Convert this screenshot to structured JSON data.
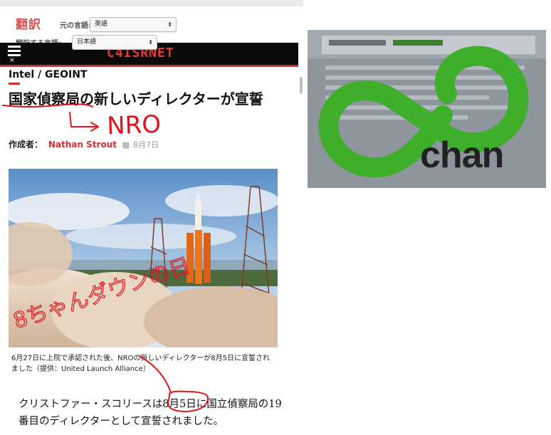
{
  "translate_bar": {
    "title": "翻訳",
    "source_label": "元の言語:",
    "source_value": "英語",
    "target_label": "翻訳する言語:",
    "target_value": "日本語"
  },
  "site": {
    "menu_close": "×",
    "logo": "C4ISRNET",
    "accent_color": "#d32f2f"
  },
  "article": {
    "category": "Intel / GEOINT",
    "headline": "国家偵察局の新しいディレクターが宣誓",
    "byline_label": "作成者：",
    "author": "Nathan Strout",
    "date": "8月7日",
    "caption": "6月27日に上院で承認された後、NROの新しいディレクターが8月5日に宣誓されました（提供：United Launch Alliance）",
    "body": "クリストファー・スコリースは8月5日に国立偵察局の19番目のディレクターとして宣誓されました。"
  },
  "annotations": {
    "nro": "NRO",
    "eight_chan_down": "8ちゃんダウンの日",
    "ink_color": "#e0141e"
  },
  "right_panel": {
    "logo_text": "chan",
    "logo_color": "#3fae2a"
  }
}
